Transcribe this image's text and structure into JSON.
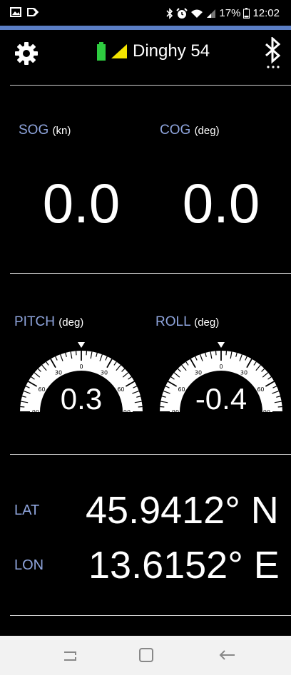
{
  "status_bar": {
    "battery_percent": "17%",
    "time": "12:02",
    "icons": [
      "image-icon",
      "cast-icon",
      "bluetooth-icon",
      "alarm-icon",
      "wifi-icon",
      "signal-icon",
      "battery-icon"
    ]
  },
  "header": {
    "device_name": "Dinghy 54",
    "settings_icon": "gear-icon",
    "connection_icon": "bluetooth-icon"
  },
  "sog": {
    "label": "SOG",
    "unit": "(kn)",
    "value": "0.0"
  },
  "cog": {
    "label": "COG",
    "unit": "(deg)",
    "value": "0.0"
  },
  "pitch": {
    "label": "PITCH",
    "unit": "(deg)",
    "value": "0.3",
    "scale_labels": [
      "0",
      "30",
      "30",
      "60",
      "60",
      "90",
      "90"
    ]
  },
  "roll": {
    "label": "ROLL",
    "unit": "(deg)",
    "value": "-0.4",
    "scale_labels": [
      "0",
      "30",
      "30",
      "60",
      "60",
      "90",
      "90"
    ]
  },
  "position": {
    "lat_label": "LAT",
    "lat_value": "45.9412° N",
    "lon_label": "LON",
    "lon_value": "13.6152° E"
  },
  "colors": {
    "accent": "#5b7fc6",
    "label": "#8fa5dd",
    "battery_green": "#2ecc40",
    "signal_yellow": "#f4e400"
  },
  "nav_bar": {
    "icons": [
      "recent-apps-icon",
      "home-icon",
      "back-icon"
    ]
  }
}
